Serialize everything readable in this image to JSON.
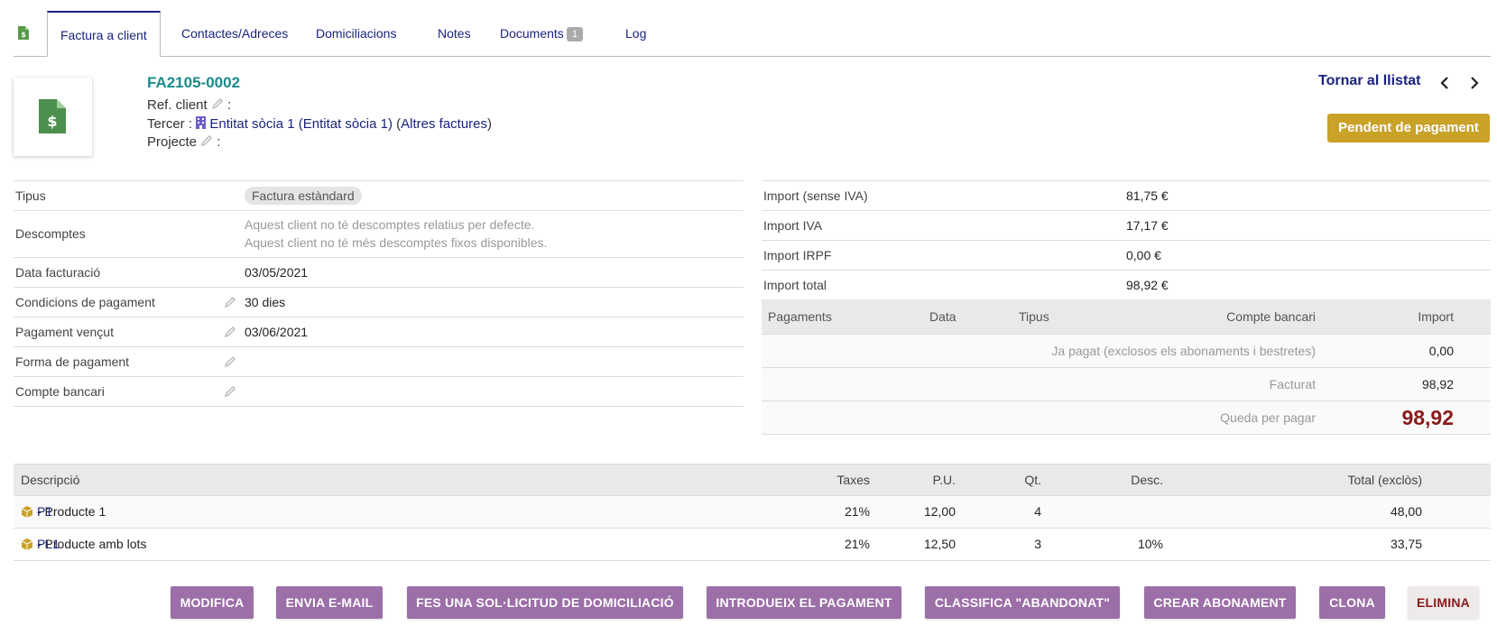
{
  "tabs": [
    {
      "label": "Factura a client"
    },
    {
      "label": "Contactes/Adreces"
    },
    {
      "label": "Domiciliacions"
    },
    {
      "label": "Notes"
    },
    {
      "label": "Documents",
      "count": "1"
    },
    {
      "label": "Log"
    }
  ],
  "header": {
    "ref": "FA2105-0002",
    "ref_client_label": "Ref. client",
    "colon": ":",
    "tercer_label": "Tercer :",
    "tercer_name": "Entitat sòcia 1 (Entitat sòcia 1)",
    "other_invoices": "Altres factures",
    "projecte_label": "Projecte",
    "back_label": "Tornar al llistat",
    "status": "Pendent de pagament"
  },
  "info": {
    "tipus_label": "Tipus",
    "tipus_value": "Factura estàndard",
    "descomptes_label": "Descomptes",
    "descomptes_line1": "Aquest client no té descomptes relatius per defecte.",
    "descomptes_line2": "Aquest client no té més descomptes fixos disponibles.",
    "data_label": "Data facturació",
    "data_value": "03/05/2021",
    "condicions_label": "Condicions de pagament",
    "condicions_value": "30 dies",
    "vencut_label": "Pagament vençut",
    "vencut_value": "03/06/2021",
    "forma_label": "Forma de pagament",
    "compte_label": "Compte bancari"
  },
  "totals": [
    {
      "label": "Import (sense IVA)",
      "value": "81,75 €"
    },
    {
      "label": "Import IVA",
      "value": "17,17 €"
    },
    {
      "label": "Import IRPF",
      "value": "0,00 €"
    },
    {
      "label": "Import total",
      "value": "98,92 €"
    }
  ],
  "payments": {
    "headers": {
      "pagaments": "Pagaments",
      "data": "Data",
      "tipus": "Tipus",
      "compte": "Compte bancari",
      "import": "Import"
    },
    "rows": [
      {
        "label": "Ja pagat (exclosos els abonaments i bestretes)",
        "value": "0,00"
      },
      {
        "label": "Facturat",
        "value": "98,92"
      },
      {
        "label": "Queda per pagar",
        "value": "98,92"
      }
    ]
  },
  "lines": {
    "headers": {
      "desc": "Descripció",
      "taxes": "Taxes",
      "pu": "P.U.",
      "qt": "Qt.",
      "discount": "Desc.",
      "total": "Total (exclòs)"
    },
    "rows": [
      {
        "ref": "P1",
        "name": " - Producte 1",
        "taxes": "21%",
        "pu": "12,00",
        "qt": "4",
        "discount": "",
        "total": "48,00"
      },
      {
        "ref": "PL1",
        "name": " - Producte amb lots",
        "taxes": "21%",
        "pu": "12,50",
        "qt": "3",
        "discount": "10%",
        "total": "33,75"
      }
    ]
  },
  "actions": {
    "modify": "MODIFICA",
    "email": "ENVIA E-MAIL",
    "direct_debit": "FES UNA SOL·LICITUD DE DOMICILIACIÓ",
    "payment": "INTRODUEIX EL PAGAMENT",
    "abandon": "CLASSIFICA \"ABANDONAT\"",
    "credit_note": "CREAR ABONAMENT",
    "clone": "CLONA",
    "delete": "ELIMINA"
  },
  "colors": {
    "accent": "#1a237e",
    "status": "#c9a227",
    "button": "#9c6fa8",
    "remain": "#8b1a1a"
  }
}
